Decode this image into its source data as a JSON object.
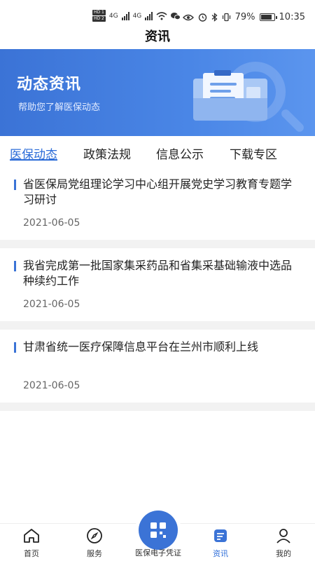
{
  "status_bar": {
    "hd1": "HD 1",
    "hd2": "HD 2",
    "net1": "4G",
    "net2": "4G",
    "battery": "79%",
    "time": "10:35"
  },
  "header": {
    "title": "资讯"
  },
  "banner": {
    "title": "动态资讯",
    "subtitle": "帮助您了解医保动态"
  },
  "tabs": [
    {
      "label": "医保动态",
      "active": true
    },
    {
      "label": "政策法规",
      "active": false
    },
    {
      "label": "信息公示",
      "active": false
    },
    {
      "label": "下载专区",
      "active": false
    }
  ],
  "news": [
    {
      "title": "省医保局党组理论学习中心组开展党史学习教育专题学习研讨",
      "date": "2021-06-05"
    },
    {
      "title": "我省完成第一批国家集采药品和省集采基础输液中选品种续约工作",
      "date": "2021-06-05"
    },
    {
      "title": "甘肃省统一医疗保障信息平台在兰州市顺利上线",
      "date": "2021-06-05"
    }
  ],
  "bottom_nav": {
    "home": "首页",
    "service": "服务",
    "center": "医保电子凭证",
    "news": "资讯",
    "mine": "我的"
  },
  "colors": {
    "accent": "#2c6cd8",
    "banner": "#3b73d6"
  },
  "icons": [
    "home-icon",
    "compass-icon",
    "qr-code-icon",
    "news-icon",
    "user-icon"
  ]
}
